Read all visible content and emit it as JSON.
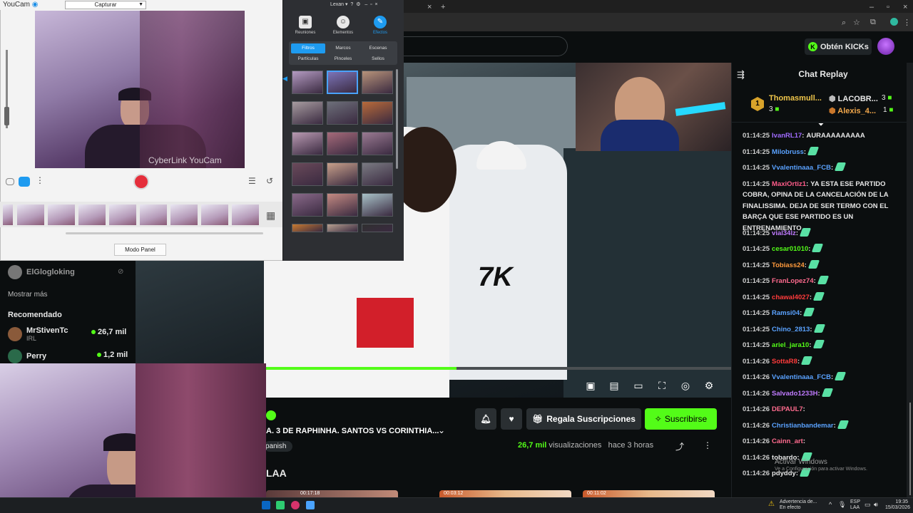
{
  "browser": {
    "tab_close": "×",
    "tab_new": "+",
    "window_controls": [
      "–",
      "▫",
      "×"
    ]
  },
  "kick": {
    "kicks_button": "Obtén KICKs",
    "stream_title": "A. 3 DE RAPHINHA. SANTOS VS CORINTHIA...",
    "language_tag": "panish",
    "gift_button": "Regala Suscripciones",
    "subscribe_button": "Suscribirse",
    "views_count": "26,7 mil",
    "views_label": "visualizaciones",
    "time_ago": "hace 3 horas",
    "section_title": "LAA",
    "progress_fraction": 0.41,
    "clip_times": [
      "00:17:18",
      "00:03:12",
      "00:11:02"
    ]
  },
  "sidebar": {
    "channel_name": "ElGlogloking",
    "show_more": "Mostrar más",
    "recommended_label": "Recomendado",
    "recommended": [
      {
        "name": "MrStivenTc",
        "category": "IRL",
        "viewers": "26,7 mil"
      },
      {
        "name": "Perry",
        "category": "",
        "viewers": "1,2 mil"
      }
    ]
  },
  "chat": {
    "title": "Chat Replay",
    "leaderboard": {
      "first": {
        "rank": "1",
        "name": "Thomasmull...",
        "count": "3"
      },
      "second": {
        "name": "LACOBR...",
        "count": "3"
      },
      "third": {
        "name": "Alexis_4...",
        "count": "1"
      }
    },
    "messages": [
      {
        "ts": "01:14:25",
        "user": "IvanRL17",
        "color": "#a06bff",
        "text": "AURAAAAAAAAA",
        "emote": false
      },
      {
        "ts": "01:14:25",
        "user": "Milobruss",
        "color": "#5aa2ff",
        "text": "",
        "emote": true
      },
      {
        "ts": "01:14:25",
        "user": "Vvalentinaaa_FCB",
        "color": "#5aa2ff",
        "text": "",
        "emote": true
      },
      {
        "ts": "01:14:25",
        "user": "MaxiOrtiz1",
        "color": "#ff5c8a",
        "text": "YA ESTA ESE PARTIDO COBRA, OPINA DE LA CANCELACIÓN DE LA FINALISSIMA. DEJA DE SER TERMO CON EL BARÇA QUE ESE PARTIDO ES UN ENTRENAMIENTO",
        "emote": false
      },
      {
        "ts": "01:14:25",
        "user": "vial34lz",
        "color": "#c07bff",
        "text": "",
        "emote": true
      },
      {
        "ts": "01:14:25",
        "user": "cesar01010",
        "color": "#53fc18",
        "text": "",
        "emote": true
      },
      {
        "ts": "01:14:25",
        "user": "Tobiass24",
        "color": "#ff9a3c",
        "text": "",
        "emote": true
      },
      {
        "ts": "01:14:25",
        "user": "FranLopez74",
        "color": "#ff6b8e",
        "text": "",
        "emote": true
      },
      {
        "ts": "01:14:25",
        "user": "chawal4027",
        "color": "#ff3b3b",
        "text": "",
        "emote": true
      },
      {
        "ts": "01:14:25",
        "user": "Ramsi04",
        "color": "#5aa2ff",
        "text": "",
        "emote": true
      },
      {
        "ts": "01:14:25",
        "user": "Chino_2813",
        "color": "#5aa2ff",
        "text": "",
        "emote": true
      },
      {
        "ts": "01:14:25",
        "user": "ariel_jara10",
        "color": "#53fc18",
        "text": "",
        "emote": true
      },
      {
        "ts": "01:14:26",
        "user": "SottaR8",
        "color": "#ff3b3b",
        "text": "",
        "emote": true
      },
      {
        "ts": "01:14:26",
        "user": "Vvalentinaaa_FCB",
        "color": "#5aa2ff",
        "text": "",
        "emote": true
      },
      {
        "ts": "01:14:26",
        "user": "Salvado1233H",
        "color": "#c07bff",
        "text": "",
        "emote": true
      },
      {
        "ts": "01:14:26",
        "user": "DEPAUL7",
        "color": "#ff6b8e",
        "text": "",
        "emote": false
      },
      {
        "ts": "01:14:26",
        "user": "Christianbandemar",
        "color": "#5aa2ff",
        "text": "",
        "emote": true
      },
      {
        "ts": "01:14:26",
        "user": "Cainn_art",
        "color": "#ff6b8e",
        "text": "",
        "emote": false
      },
      {
        "ts": "01:14:26",
        "user": "tobardo",
        "color": "#e7e7e7",
        "text": "",
        "emote": true
      },
      {
        "ts": "01:14:26",
        "user": "pdyddy",
        "color": "#e7e7e7",
        "text": "",
        "emote": true
      }
    ]
  },
  "windows": {
    "activate_title": "Activar Windows",
    "activate_sub": "Ve a Configuración para activar Windows.",
    "weather": "Advertencia de...",
    "weather_sub": "En efecto",
    "lang": "ESP",
    "lang_sub": "LAA",
    "time": "19:35",
    "date": "15/03/2026"
  },
  "youcam": {
    "app_name": "YouCam",
    "mode_dropdown": "Capturar",
    "watermark": "CyberLink YouCam",
    "panel_user": "Lexan",
    "tabs": [
      "Reuniones",
      "Elementos",
      "Efectos"
    ],
    "fx_tabs": [
      "Filtros",
      "Marcos",
      "Escenas",
      "Partículas",
      "Pinceles",
      "Sellos"
    ],
    "modo_panel": "Modo Panel"
  }
}
